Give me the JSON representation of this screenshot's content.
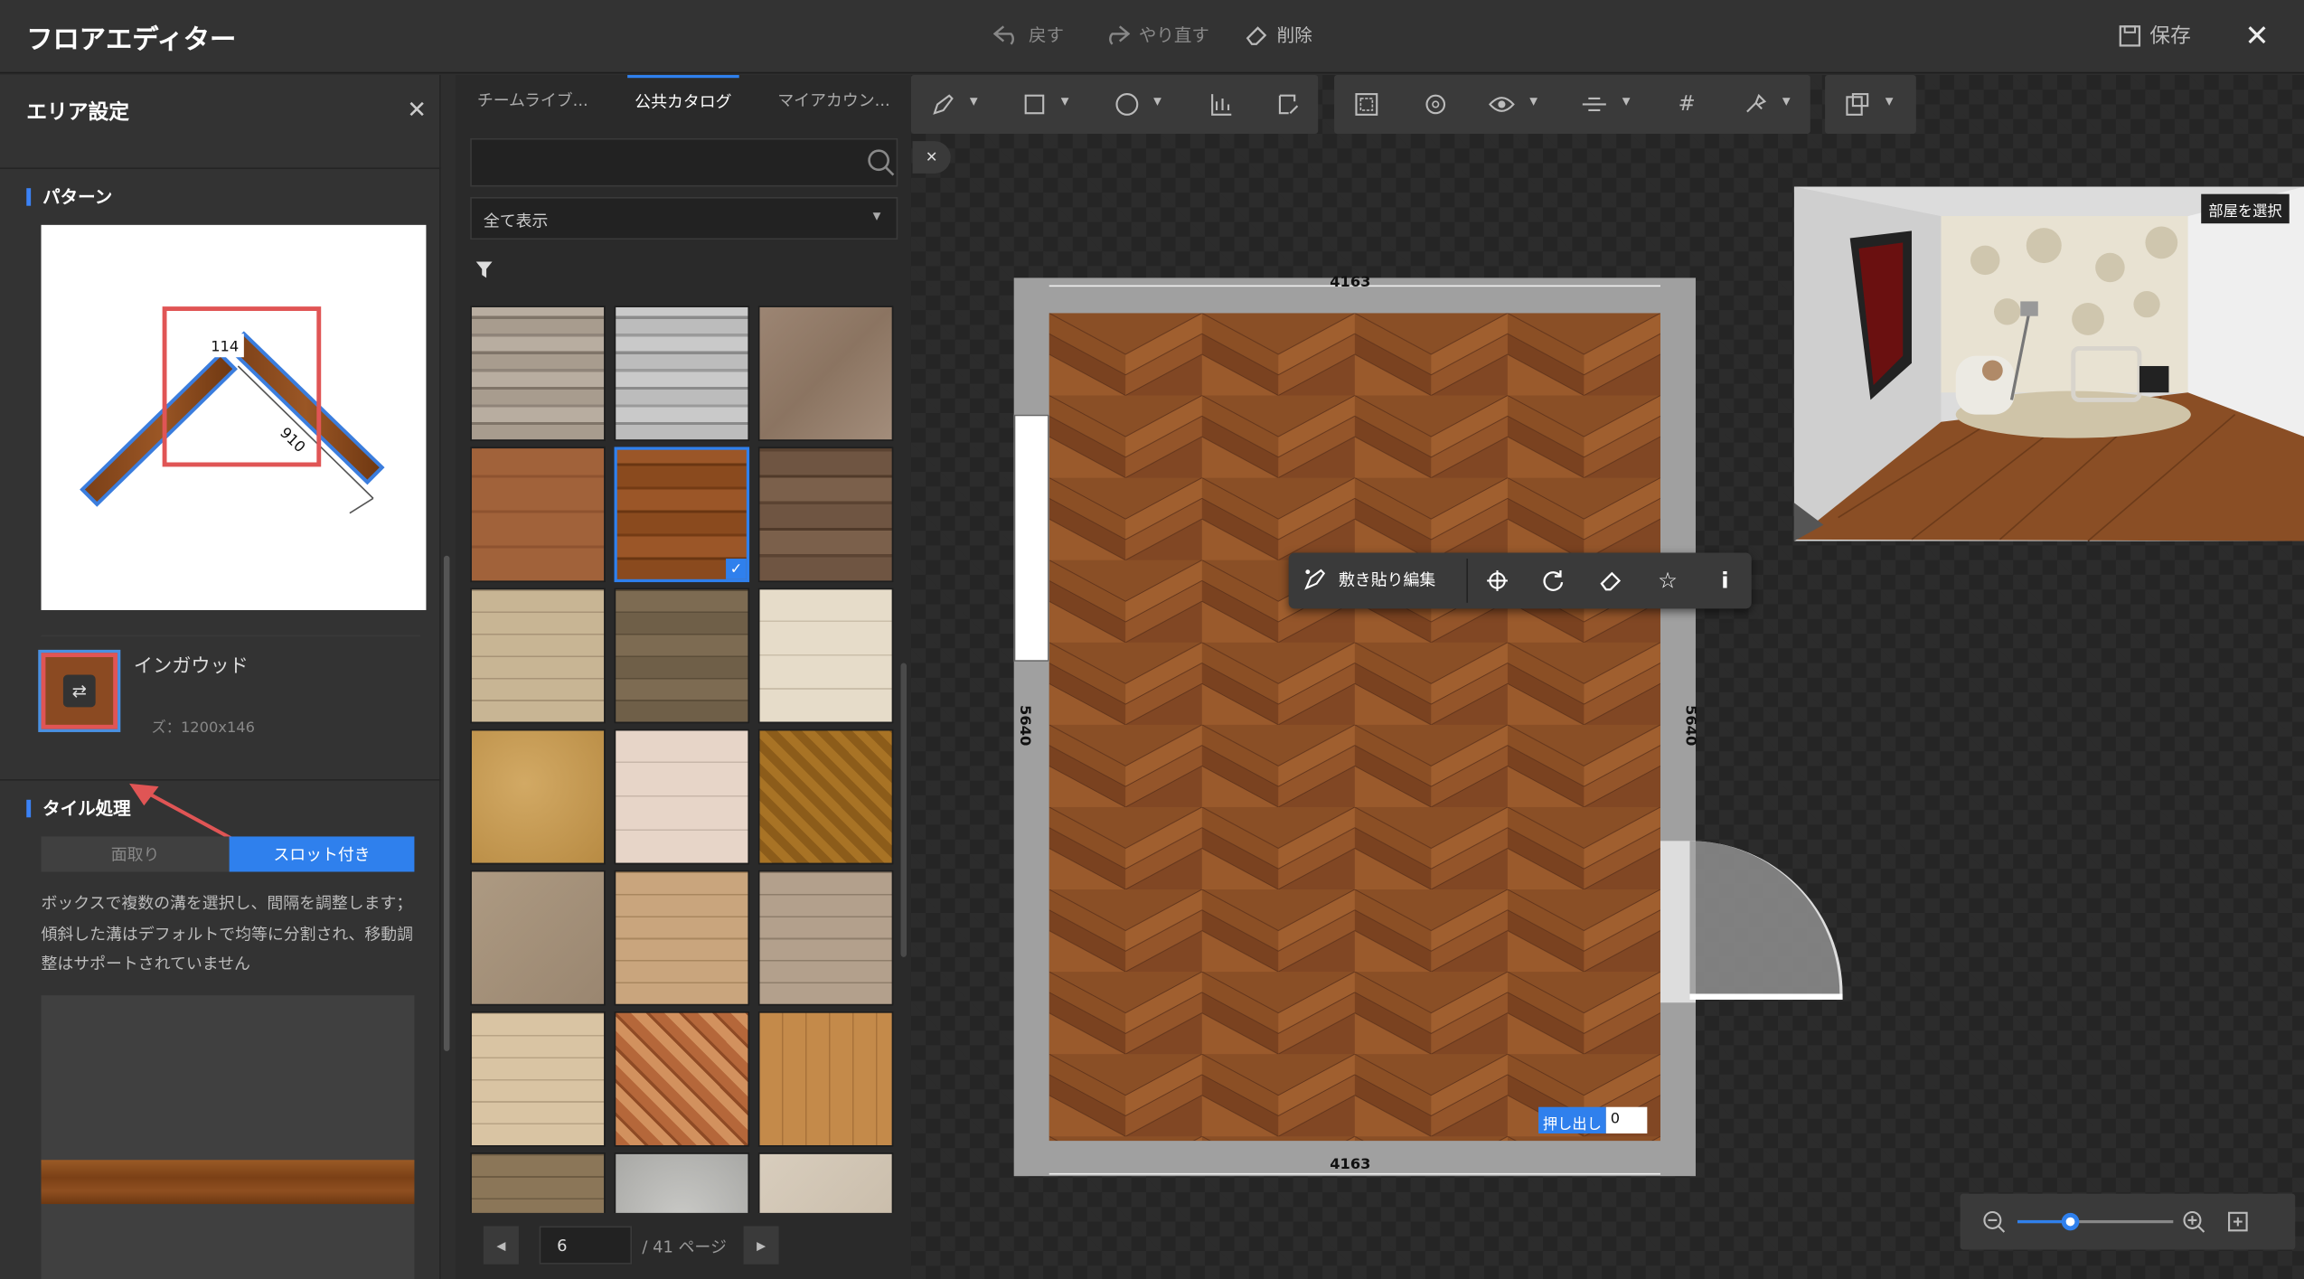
{
  "title": "フロアエディター",
  "titlebar": {
    "undo": "戻す",
    "redo": "やり直す",
    "delete": "削除",
    "save": "保存"
  },
  "left_panel": {
    "title": "エリア設定",
    "pattern_section": "パターン",
    "pattern_dims": {
      "width": "114",
      "length": "910"
    },
    "material_name": "インガウッド",
    "material_size": "ズ：1200x146",
    "tile_section": "タイル処理",
    "tile_tabs": [
      "面取り",
      "スロット付き"
    ],
    "tile_description": "ボックスで複数の溝を選択し、間隔を調整します；傾斜した溝はデフォルトで均等に分割され、移動調整はサポートされていません"
  },
  "catalog": {
    "tabs": [
      "チームライブ...",
      "公共カタログ",
      "マイアカウン..."
    ],
    "active_tab": "公共カタログ",
    "filter": "全て表示",
    "current_page": "6",
    "total_pages": "/ 41 ページ"
  },
  "room": {
    "dim_top": "4163",
    "dim_bottom": "4163",
    "dim_left": "5640",
    "dim_right": "5640",
    "extrude_label": "押し出し",
    "extrude_value": "0"
  },
  "context_menu": {
    "edit_label": "敷き貼り編集"
  },
  "preview": {
    "select_room": "部屋を選択"
  },
  "icons": [
    "arrow-undo",
    "arrow-redo",
    "eraser",
    "floppy",
    "close",
    "search",
    "funnel",
    "pen",
    "square",
    "circle",
    "eye",
    "grid",
    "crosshair",
    "rotate",
    "star",
    "info",
    "zoom-in",
    "zoom-out",
    "fit"
  ],
  "colors": {
    "accent": "#2f80ed",
    "highlight": "#e05555"
  }
}
